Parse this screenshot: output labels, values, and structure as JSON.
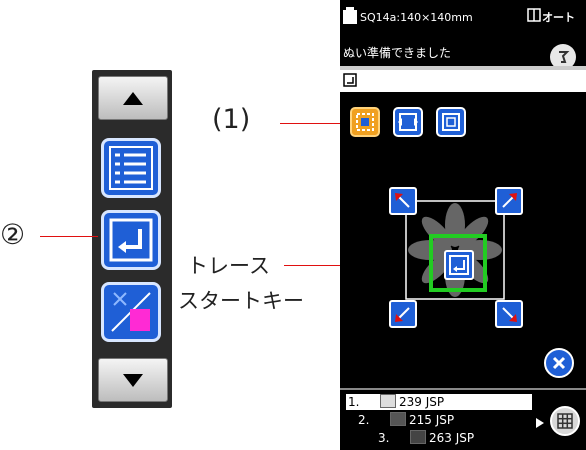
{
  "callouts": {
    "label_1": "(1)",
    "label_2": "②",
    "trace_line1": "トレース",
    "trace_line2": "スタートキー"
  },
  "toolbar": {
    "up_icon": "triangle-up",
    "list_icon": "stitch-list",
    "trace_icon": "trace-start",
    "thread_icon": "thread-spool",
    "down_icon": "triangle-down"
  },
  "screen": {
    "header_title": "SQ14a:140×140mm",
    "header_mode": "オート",
    "status_text": "ぬい準備できました",
    "thread_list": [
      {
        "num": "1.",
        "value": "239 JSP"
      },
      {
        "num": "2.",
        "value": "215 JSP"
      },
      {
        "num": "3.",
        "value": "263 JSP"
      }
    ]
  },
  "colors": {
    "accent_blue": "#1f5fd6",
    "highlight_orange": "#f0a020",
    "trace_green": "#22cc22",
    "callout_red": "#e01010"
  }
}
